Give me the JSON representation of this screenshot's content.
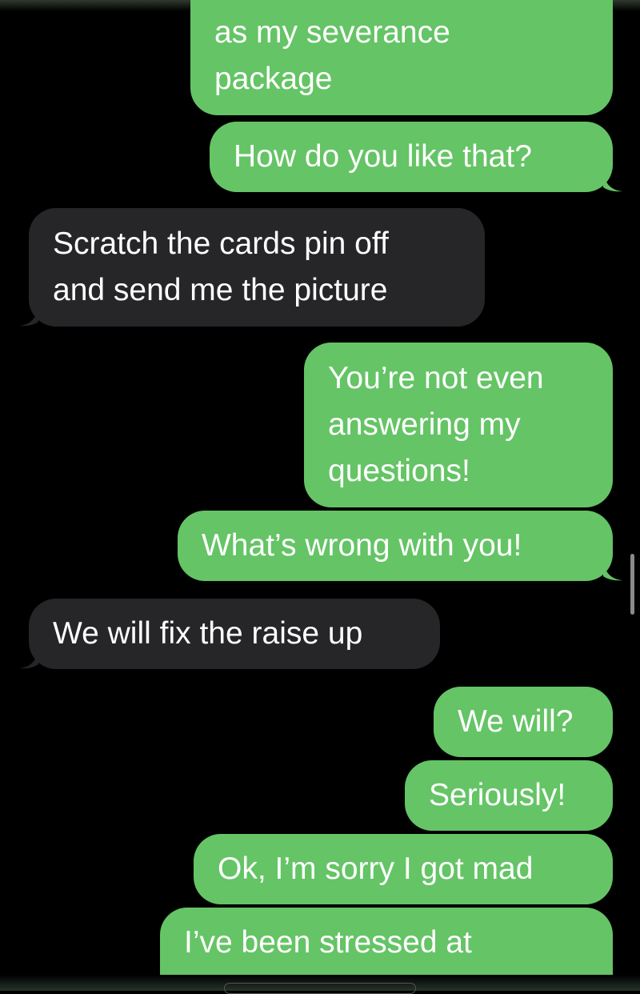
{
  "conversation": {
    "messages": [
      {
        "direction": "sent",
        "text": "as my severance\npackage"
      },
      {
        "direction": "sent",
        "text": "How do you like that?"
      },
      {
        "direction": "received",
        "text": "Scratch the cards pin off\nand send me the picture"
      },
      {
        "direction": "sent",
        "text": "You’re not even\nanswering my\nquestions!"
      },
      {
        "direction": "sent",
        "text": "What’s wrong with you!"
      },
      {
        "direction": "received",
        "text": "We will fix the raise up"
      },
      {
        "direction": "sent",
        "text": "We will?"
      },
      {
        "direction": "sent",
        "text": "Seriously!"
      },
      {
        "direction": "sent",
        "text": "Ok, I’m sorry I got mad"
      },
      {
        "direction": "sent",
        "text": "I’ve been stressed at"
      }
    ]
  },
  "colors": {
    "sent_bubble": "#65c466",
    "received_bubble": "#262629",
    "background": "#000000",
    "text": "#ffffff"
  }
}
